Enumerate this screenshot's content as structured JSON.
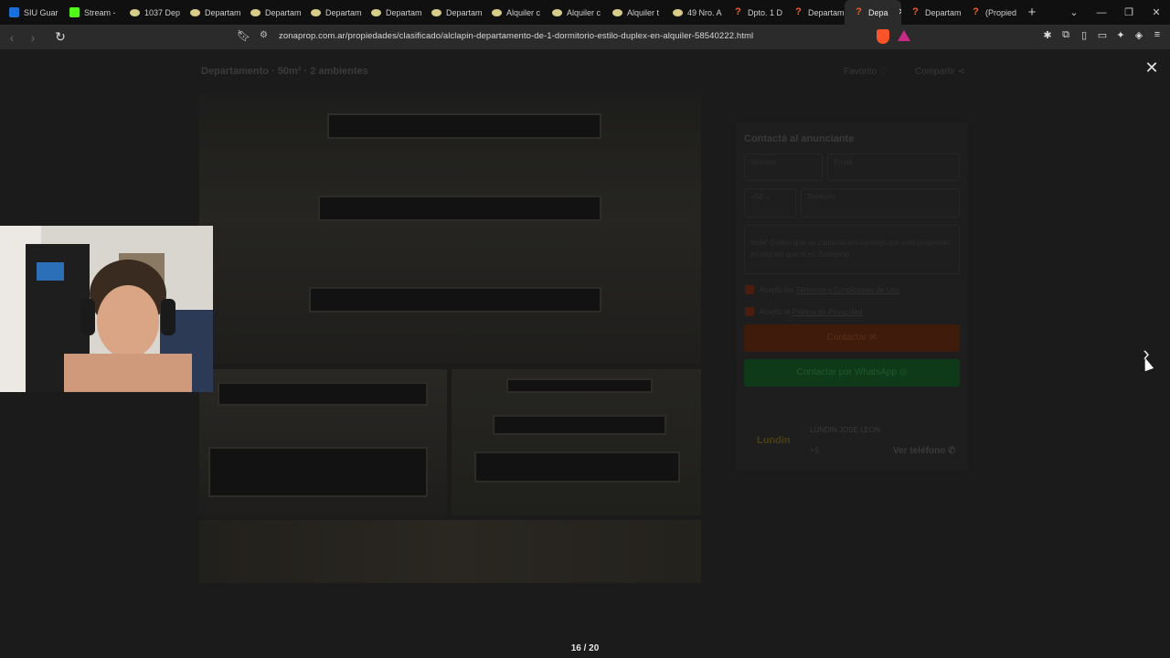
{
  "tabs": [
    {
      "label": "SIU Guar",
      "favicon": "siu-icon"
    },
    {
      "label": "Stream -",
      "favicon": "kick-icon"
    },
    {
      "label": "1037 Dep",
      "favicon": "egg-icon"
    },
    {
      "label": "Departam",
      "favicon": "egg-icon"
    },
    {
      "label": "Departam",
      "favicon": "egg-icon"
    },
    {
      "label": "Departam",
      "favicon": "egg-icon"
    },
    {
      "label": "Departam",
      "favicon": "egg-icon"
    },
    {
      "label": "Departam",
      "favicon": "egg-icon"
    },
    {
      "label": "Alquiler c",
      "favicon": "egg-icon"
    },
    {
      "label": "Alquiler c",
      "favicon": "egg-icon"
    },
    {
      "label": "Alquiler t",
      "favicon": "egg-icon"
    },
    {
      "label": "49 Nro. A",
      "favicon": "egg-icon"
    },
    {
      "label": "Dpto. 1 D",
      "favicon": "zonaprop-icon"
    },
    {
      "label": "Departam",
      "favicon": "zonaprop-icon"
    },
    {
      "label": "Depa",
      "favicon": "zonaprop-icon",
      "active": true
    },
    {
      "label": "Departam",
      "favicon": "zonaprop-icon"
    },
    {
      "label": "(Propied",
      "favicon": "zonaprop-icon"
    }
  ],
  "toolbar": {
    "url": "zonaprop.com.ar/propiedades/clasificado/alclapin-departamento-de-1-dormitorio-estilo-duplex-en-alquiler-58540222.html"
  },
  "gallery": {
    "listing_title": "Departamento · 50m² · 2 ambientes",
    "favorite_label": "Favorito",
    "share_label": "Compartir",
    "counter": "16 / 20"
  },
  "contact_form": {
    "title": "Contactá al anunciante",
    "name_placeholder": "Nombre",
    "email_placeholder": "Email",
    "phone_code": "+54",
    "phone_placeholder": "Teléfono",
    "message": "Hola! Quiero que se comuniquen conmigo por esta propiedad en alquiler que vi en Zonaprop.",
    "terms_prefix": "Acepto los",
    "terms_link": "Términos y Condiciones de Uso",
    "privacy_prefix": "Acepto la",
    "privacy_link": "Política de Privacidad",
    "contact_button": "Contactar",
    "whatsapp_button": "Contactar por WhatsApp"
  },
  "agent": {
    "logo_text": "Lundin",
    "name": "LUNDIN JOSE LEON",
    "phone": "+5",
    "see_phone": "Ver teléfono"
  },
  "colors": {
    "brand_orange": "#ff5a1f",
    "whatsapp_green": "#25d366",
    "backdrop": "#1b1b1b"
  }
}
